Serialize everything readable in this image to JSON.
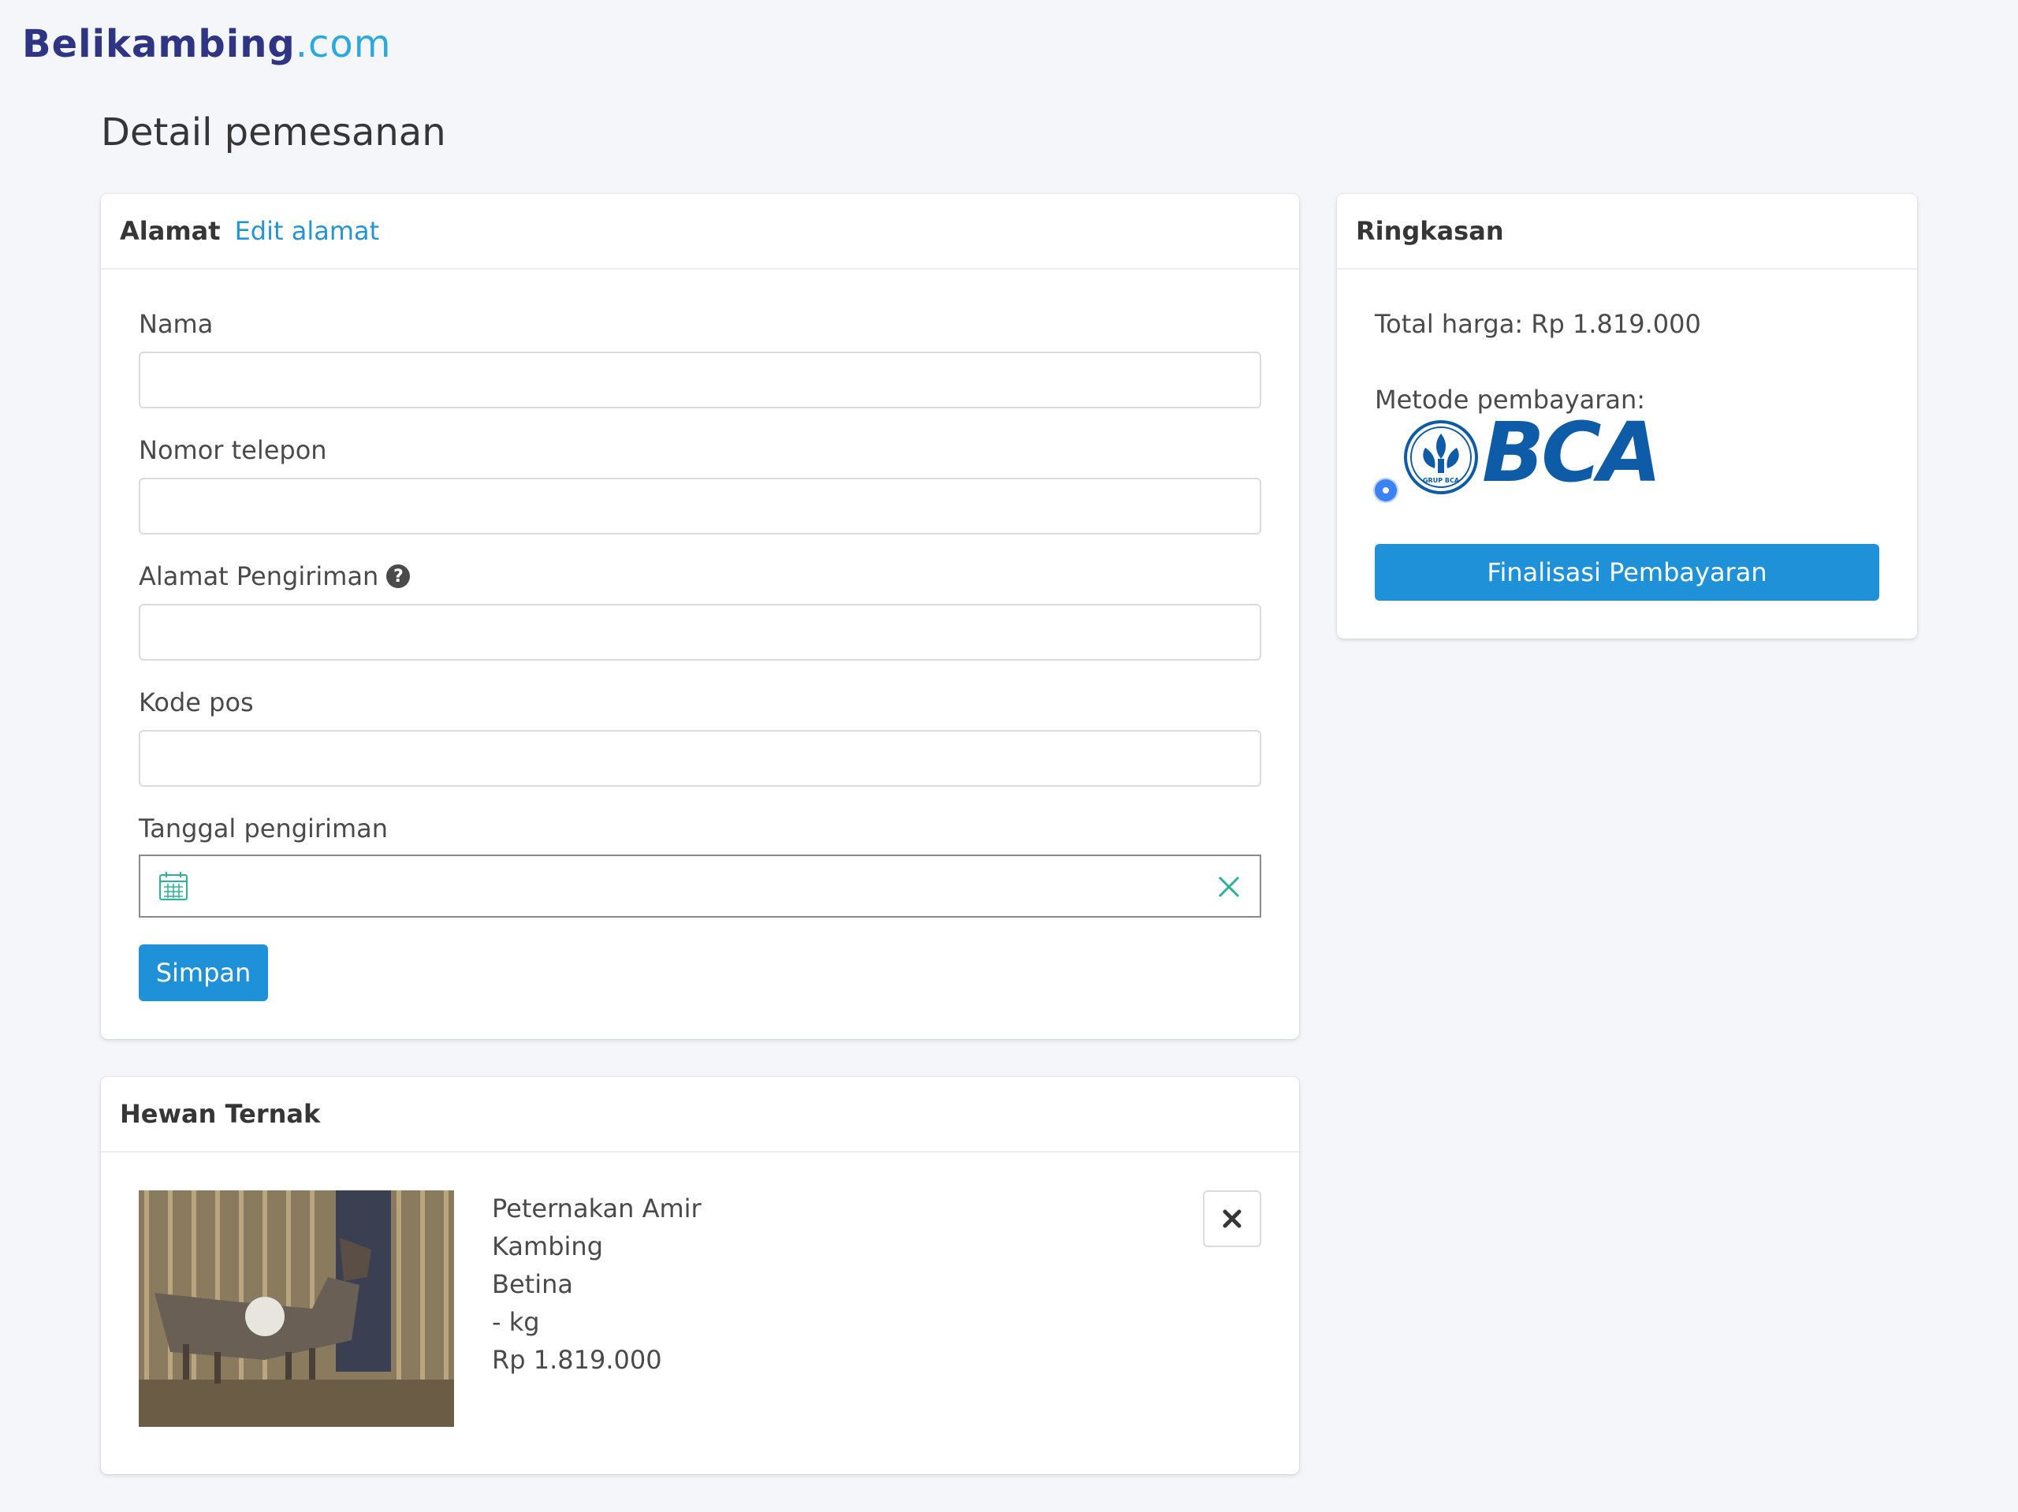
{
  "logo": {
    "brand": "Belikambing",
    "tld": ".com"
  },
  "page_title": "Detail pemesanan",
  "alamat_card": {
    "title": "Alamat",
    "edit_link": "Edit alamat",
    "fields": {
      "nama": {
        "label": "Nama",
        "value": ""
      },
      "telepon": {
        "label": "Nomor telepon",
        "value": ""
      },
      "alamat": {
        "label": "Alamat Pengiriman",
        "value": ""
      },
      "kodepos": {
        "label": "Kode pos",
        "value": ""
      },
      "tanggal": {
        "label": "Tanggal pengiriman",
        "value": ""
      }
    },
    "save_button": "Simpan"
  },
  "summary_card": {
    "title": "Ringkasan",
    "total_label": "Total harga: Rp 1.819.000",
    "payment_label": "Metode pembayaran:",
    "payment_option": {
      "bank": "BCA",
      "emblem_text": "GRUP BCA",
      "selected": true
    },
    "finalize_button": "Finalisasi Pembayaran"
  },
  "hewan_card": {
    "title": "Hewan Ternak",
    "item": {
      "farm": "Peternakan Amir",
      "type": "Kambing",
      "sex": "Betina",
      "weight": "- kg",
      "price": "Rp 1.819.000"
    }
  },
  "colors": {
    "primary": "#1f91d8",
    "link": "#2594d4",
    "logo_dark": "#2f3485",
    "logo_light": "#2aa8e0",
    "bca_blue": "#0e5ba7",
    "teal_icon": "#2bb39a",
    "background": "#f5f6fa"
  },
  "icons": {
    "help": "question-circle-icon",
    "calendar": "calendar-icon",
    "clear": "close-icon",
    "delete": "times-icon"
  }
}
